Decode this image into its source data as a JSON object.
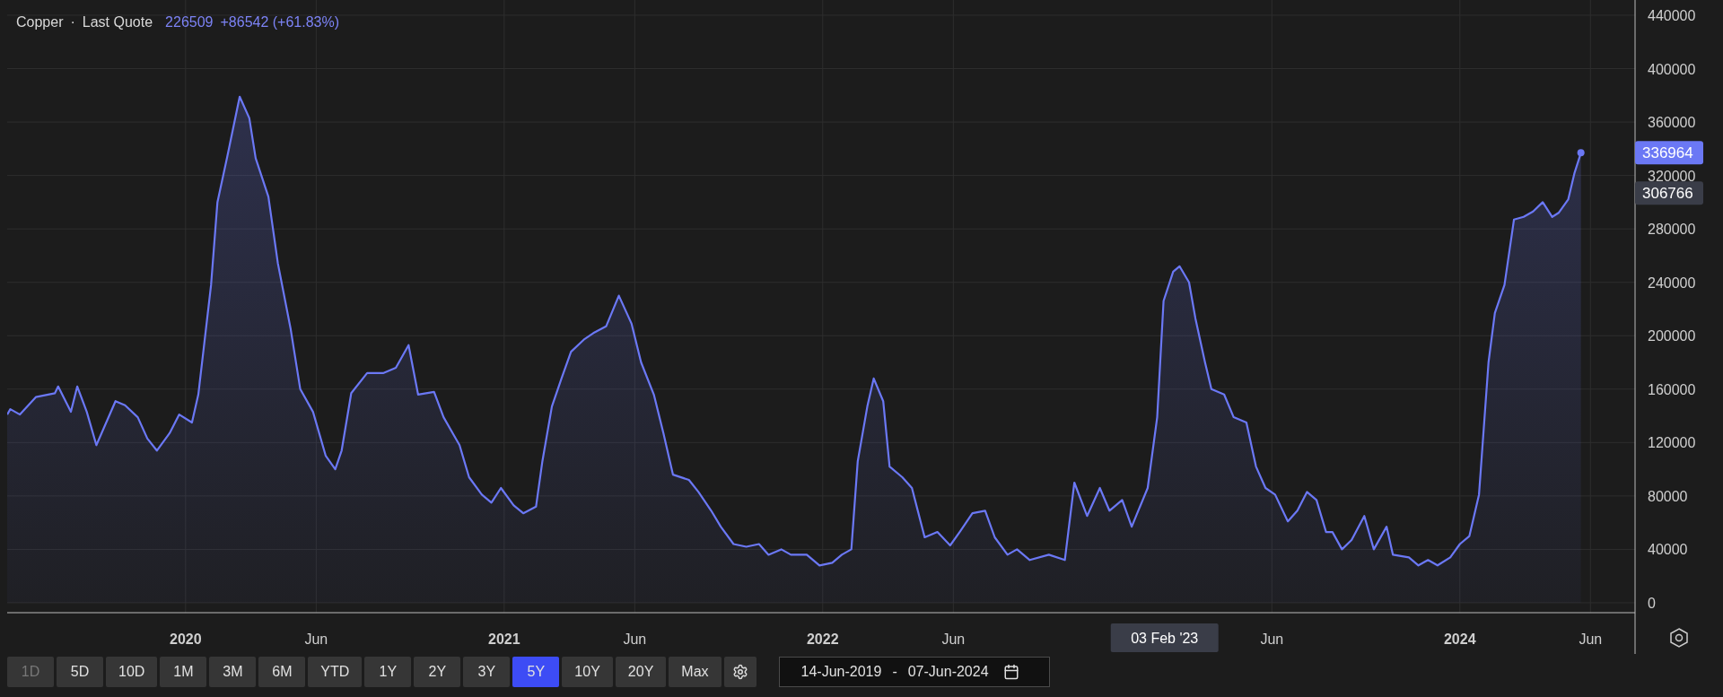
{
  "legend": {
    "separator": "·",
    "field": "Last Quote",
    "value": "226509",
    "change": "+86542 (+61.83%)"
  },
  "chart": {
    "price_badges": [
      {
        "kind": "last",
        "text": "336964"
      },
      {
        "kind": "crosshair",
        "text": "306766"
      }
    ],
    "crosshair_date": "03 Feb '23",
    "chart_data": {
      "type": "area",
      "grid": true,
      "x": [
        2019.44,
        2019.45,
        2019.48,
        2019.53,
        2019.59,
        2019.6,
        2019.64,
        2019.66,
        2019.69,
        2019.72,
        2019.78,
        2019.81,
        2019.85,
        2019.88,
        2019.91,
        2019.95,
        2019.98,
        2020.02,
        2020.04,
        2020.08,
        2020.1,
        2020.13,
        2020.17,
        2020.2,
        2020.22,
        2020.26,
        2020.29,
        2020.33,
        2020.36,
        2020.4,
        2020.44,
        2020.47,
        2020.49,
        2020.52,
        2020.57,
        2020.62,
        2020.66,
        2020.7,
        2020.73,
        2020.78,
        2020.81,
        2020.86,
        2020.89,
        2020.93,
        2020.96,
        2020.99,
        2021.03,
        2021.06,
        2021.1,
        2021.12,
        2021.15,
        2021.18,
        2021.21,
        2021.25,
        2021.28,
        2021.32,
        2021.36,
        2021.4,
        2021.43,
        2021.47,
        2021.5,
        2021.53,
        2021.58,
        2021.61,
        2021.65,
        2021.68,
        2021.72,
        2021.76,
        2021.8,
        2021.83,
        2021.87,
        2021.9,
        2021.95,
        2021.99,
        2022.03,
        2022.06,
        2022.09,
        2022.11,
        2022.14,
        2022.16,
        2022.19,
        2022.21,
        2022.25,
        2022.28,
        2022.32,
        2022.36,
        2022.4,
        2022.43,
        2022.47,
        2022.51,
        2022.54,
        2022.58,
        2022.61,
        2022.65,
        2022.71,
        2022.76,
        2022.79,
        2022.83,
        2022.87,
        2022.9,
        2022.94,
        2022.97,
        2023.02,
        2023.05,
        2023.07,
        2023.1,
        2023.12,
        2023.15,
        2023.17,
        2023.2,
        2023.22,
        2023.26,
        2023.29,
        2023.33,
        2023.36,
        2023.39,
        2023.42,
        2023.46,
        2023.49,
        2023.52,
        2023.55,
        2023.58,
        2023.6,
        2023.63,
        2023.66,
        2023.7,
        2023.73,
        2023.77,
        2023.79,
        2023.84,
        2023.87,
        2023.9,
        2023.93,
        2023.97,
        2024.0,
        2024.03,
        2024.06,
        2024.09,
        2024.11,
        2024.14,
        2024.17,
        2024.2,
        2024.23,
        2024.26,
        2024.29,
        2024.31,
        2024.34,
        2024.36,
        2024.38
      ],
      "series": [
        {
          "name": "Copper",
          "color": "#6b78f5",
          "values": [
            141000,
            145000,
            141000,
            154000,
            157000,
            162000,
            143000,
            162000,
            143000,
            118000,
            151000,
            148000,
            139000,
            123000,
            114000,
            127000,
            141000,
            135000,
            156000,
            238000,
            300000,
            333000,
            379000,
            363000,
            333000,
            304000,
            254000,
            205000,
            160000,
            143000,
            110000,
            100000,
            114000,
            157000,
            172000,
            172000,
            176000,
            193000,
            156000,
            158000,
            139000,
            118000,
            94000,
            81000,
            75000,
            86000,
            73000,
            67000,
            72000,
            106000,
            147000,
            168000,
            188000,
            197000,
            202000,
            207000,
            230000,
            209000,
            180000,
            156000,
            127000,
            96000,
            92000,
            83000,
            69000,
            57000,
            44000,
            42000,
            44000,
            36000,
            40000,
            36000,
            36000,
            28000,
            30000,
            36000,
            40000,
            106000,
            147000,
            168000,
            151000,
            102000,
            94000,
            86000,
            49000,
            53000,
            43000,
            53000,
            67000,
            69000,
            49000,
            36000,
            40000,
            32000,
            36000,
            32000,
            90000,
            65000,
            86000,
            69000,
            77000,
            57000,
            86000,
            139000,
            226000,
            248000,
            252000,
            240000,
            213000,
            180000,
            160000,
            156000,
            139000,
            135000,
            102000,
            86000,
            81000,
            61000,
            69000,
            83000,
            77000,
            53000,
            53000,
            40000,
            47000,
            65000,
            40000,
            57000,
            36000,
            34000,
            28000,
            32000,
            28000,
            34000,
            44000,
            50000,
            81000,
            180000,
            217000,
            238000,
            287000,
            289000,
            293000,
            300000,
            289000,
            292000,
            302000,
            322000,
            337000
          ]
        }
      ],
      "xlim": [
        2019.44,
        2024.55
      ],
      "ylim": [
        -7400,
        451400
      ],
      "xticks": [
        {
          "value": 2020,
          "label": "2020"
        },
        {
          "value": 2020.41,
          "label": "Jun"
        },
        {
          "value": 2021,
          "label": "2021"
        },
        {
          "value": 2021.41,
          "label": "Jun"
        },
        {
          "value": 2022,
          "label": "2022"
        },
        {
          "value": 2022.41,
          "label": "Jun"
        },
        {
          "value": 2023.41,
          "label": "Jun"
        },
        {
          "value": 2024,
          "label": "2024"
        },
        {
          "value": 2024.41,
          "label": "Jun"
        }
      ],
      "yticks": [
        0,
        40000,
        80000,
        120000,
        160000,
        200000,
        240000,
        280000,
        320000,
        360000,
        400000,
        440000
      ]
    }
  },
  "periods": [
    {
      "label": "1D",
      "selected": false,
      "disabled": true
    },
    {
      "label": "5D",
      "selected": false,
      "disabled": false
    },
    {
      "label": "10D",
      "selected": false,
      "disabled": false
    },
    {
      "label": "1M",
      "selected": false,
      "disabled": false
    },
    {
      "label": "3M",
      "selected": false,
      "disabled": false
    },
    {
      "label": "6M",
      "selected": false,
      "disabled": false
    },
    {
      "label": "YTD",
      "selected": false,
      "disabled": false
    },
    {
      "label": "1Y",
      "selected": false,
      "disabled": false
    },
    {
      "label": "2Y",
      "selected": false,
      "disabled": false
    },
    {
      "label": "3Y",
      "selected": false,
      "disabled": false
    },
    {
      "label": "5Y",
      "selected": true,
      "disabled": false
    },
    {
      "label": "10Y",
      "selected": false,
      "disabled": false
    },
    {
      "label": "20Y",
      "selected": false,
      "disabled": false
    },
    {
      "label": "Max",
      "selected": false,
      "disabled": false
    }
  ],
  "date_range": {
    "start": "14-Jun-2019",
    "separator": "-",
    "end": "07-Jun-2024"
  }
}
